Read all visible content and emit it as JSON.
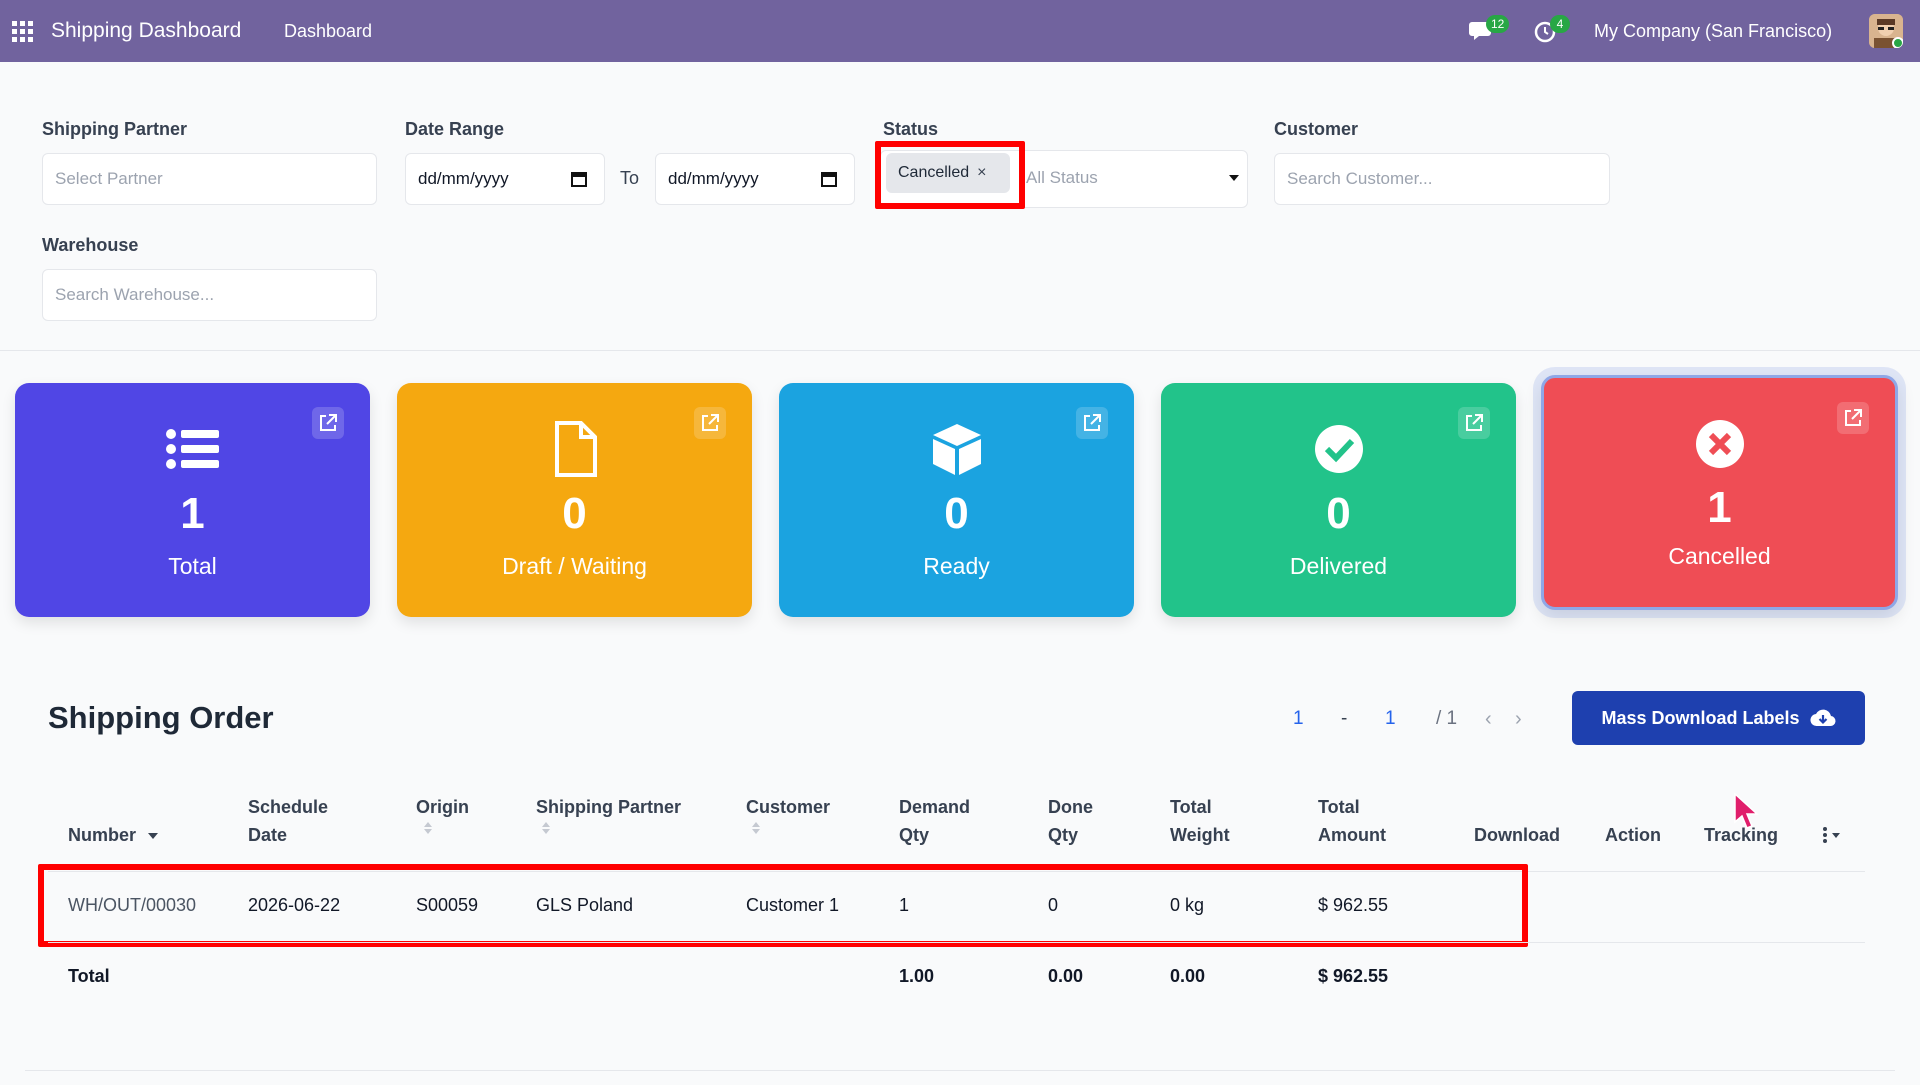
{
  "topbar": {
    "app_title": "Shipping Dashboard",
    "menu_item": "Dashboard",
    "messages_count": "12",
    "activities_count": "4",
    "company": "My Company (San Francisco)"
  },
  "filters": {
    "shipping_partner": {
      "label": "Shipping Partner",
      "placeholder": "Select Partner"
    },
    "date_range": {
      "label": "Date Range",
      "from_placeholder": "dd/mm/yyyy",
      "to_label": "To",
      "to_placeholder": "dd/mm/yyyy"
    },
    "status": {
      "label": "Status",
      "selected_chip": "Cancelled",
      "remove_glyph": "×",
      "placeholder": "All Status"
    },
    "customer": {
      "label": "Customer",
      "placeholder": "Search Customer..."
    },
    "warehouse": {
      "label": "Warehouse",
      "placeholder": "Search Warehouse..."
    }
  },
  "cards": [
    {
      "label": "Total",
      "count": "1",
      "color": "#5046e5",
      "icon": "list-icon"
    },
    {
      "label": "Draft / Waiting",
      "count": "0",
      "color": "#f5a810",
      "icon": "document-icon"
    },
    {
      "label": "Ready",
      "count": "0",
      "color": "#1ba3e0",
      "icon": "box-icon"
    },
    {
      "label": "Delivered",
      "count": "0",
      "color": "#22c38a",
      "icon": "check-circle-icon"
    },
    {
      "label": "Cancelled",
      "count": "1",
      "color": "#ef4d55",
      "icon": "x-circle-icon"
    }
  ],
  "orders": {
    "title": "Shipping Order",
    "pager": {
      "start": "1",
      "sep": "-",
      "end": "1",
      "total": "/ 1"
    },
    "mass_download_label": "Mass Download Labels",
    "columns": {
      "number": "Number",
      "schedule_date_1": "Schedule",
      "schedule_date_2": "Date",
      "origin": "Origin",
      "shipping_partner": "Shipping Partner",
      "customer": "Customer",
      "demand_qty_1": "Demand",
      "demand_qty_2": "Qty",
      "done_qty_1": "Done",
      "done_qty_2": "Qty",
      "total_weight_1": "Total",
      "total_weight_2": "Weight",
      "total_amount_1": "Total",
      "total_amount_2": "Amount",
      "download": "Download",
      "action": "Action",
      "tracking": "Tracking"
    },
    "rows": [
      {
        "number": "WH/OUT/00030",
        "schedule_date": "2026-06-22",
        "origin": "S00059",
        "shipping_partner": "GLS Poland",
        "customer": "Customer 1",
        "demand_qty": "1",
        "done_qty": "0",
        "total_weight": "0 kg",
        "total_amount": "$ 962.55"
      }
    ],
    "totals": {
      "label": "Total",
      "demand_qty": "1.00",
      "done_qty": "0.00",
      "total_weight": "0.00",
      "total_amount": "$ 962.55"
    }
  }
}
